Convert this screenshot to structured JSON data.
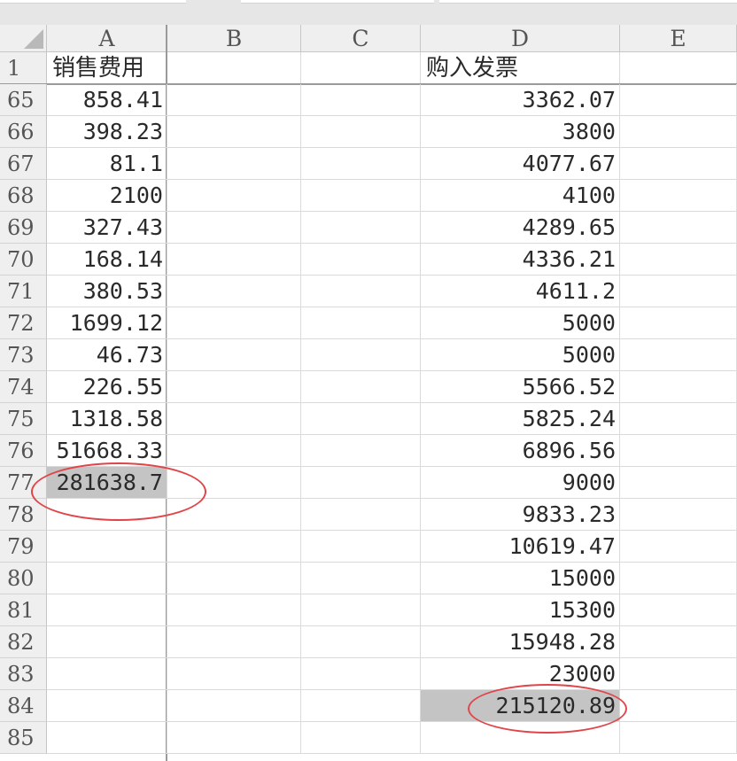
{
  "columns": [
    "A",
    "B",
    "C",
    "D",
    "E"
  ],
  "header_row": {
    "number": "1",
    "A": "销售费用",
    "D": "购入发票"
  },
  "rows": [
    {
      "number": "65",
      "A": "858.41",
      "D": "3362.07"
    },
    {
      "number": "66",
      "A": "398.23",
      "D": "3800"
    },
    {
      "number": "67",
      "A": "81.1",
      "D": "4077.67"
    },
    {
      "number": "68",
      "A": "2100",
      "D": "4100"
    },
    {
      "number": "69",
      "A": "327.43",
      "D": "4289.65"
    },
    {
      "number": "70",
      "A": "168.14",
      "D": "4336.21"
    },
    {
      "number": "71",
      "A": "380.53",
      "D": "4611.2"
    },
    {
      "number": "72",
      "A": "1699.12",
      "D": "5000"
    },
    {
      "number": "73",
      "A": "46.73",
      "D": "5000"
    },
    {
      "number": "74",
      "A": "226.55",
      "D": "5566.52"
    },
    {
      "number": "75",
      "A": "1318.58",
      "D": "5825.24"
    },
    {
      "number": "76",
      "A": "51668.33",
      "D": "6896.56"
    },
    {
      "number": "77",
      "A": "281638.7",
      "D": "9000"
    },
    {
      "number": "78",
      "A": "",
      "D": "9833.23"
    },
    {
      "number": "79",
      "A": "",
      "D": "10619.47"
    },
    {
      "number": "80",
      "A": "",
      "D": "15000"
    },
    {
      "number": "81",
      "A": "",
      "D": "15300"
    },
    {
      "number": "82",
      "A": "",
      "D": "15948.28"
    },
    {
      "number": "83",
      "A": "",
      "D": "23000"
    },
    {
      "number": "84",
      "A": "",
      "D": "215120.89"
    },
    {
      "number": "85",
      "A": "",
      "D": ""
    }
  ],
  "highlight_color": "#c4c4c4",
  "annotation_color": "#e0454a"
}
